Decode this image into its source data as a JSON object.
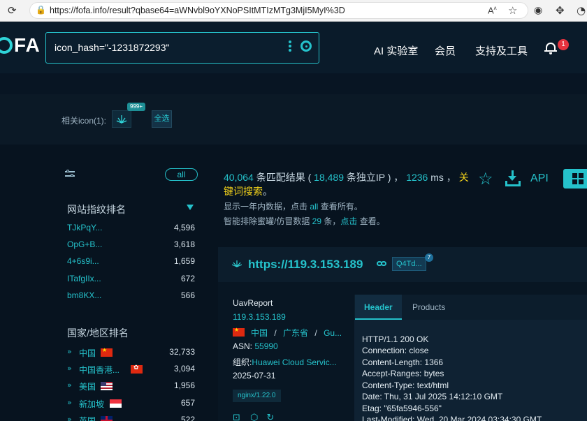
{
  "browser": {
    "url": "https://fofa.info/result?qbase64=aWNvbl9oYXNoPSItMTIzMTg3MjI5MyI%3D",
    "reader_label": "A",
    "icons": [
      "back-icon",
      "refresh-icon",
      "lock-icon",
      "read-aloud-icon",
      "favorite-icon",
      "browser-essentials-icon",
      "extensions-icon",
      "profile-icon"
    ]
  },
  "header": {
    "logo_text": "FA",
    "search_query": "icon_hash=\"-1231872293\"",
    "nav": [
      "AI 实验室",
      "会员",
      "支持及工具"
    ],
    "notification_count": "1"
  },
  "related_icons": {
    "label": "相关icon(1):",
    "count_badge": "999+",
    "select_all": "全选"
  },
  "sidebar": {
    "all_label": "all",
    "fingerprint_title": "网站指纹排名",
    "fingerprints": [
      {
        "name": "TJkPqY...",
        "count": "4,596"
      },
      {
        "name": "OpG+B...",
        "count": "3,618"
      },
      {
        "name": "4+6s9i...",
        "count": "1,659"
      },
      {
        "name": "ITafgIIx...",
        "count": "672"
      },
      {
        "name": "bm8KX...",
        "count": "566"
      }
    ],
    "country_title": "国家/地区排名",
    "countries": [
      {
        "name": "中国",
        "count": "32,733",
        "flag": "cn"
      },
      {
        "name": "中国香港...",
        "count": "3,094",
        "flag": "hk"
      },
      {
        "name": "美国",
        "count": "1,956",
        "flag": "us"
      },
      {
        "name": "新加坡",
        "count": "657",
        "flag": "sg"
      },
      {
        "name": "英国",
        "count": "522",
        "flag": "gb"
      }
    ]
  },
  "summary": {
    "total": "40,064",
    "total_suffix": " 条匹配结果 ( ",
    "unique_ip": "18,489",
    "unique_suffix": " 条独立IP ) ， ",
    "time": "1236",
    "time_suffix": " ms ， ",
    "keyword": "关键词搜索",
    "end": "。",
    "line2_prefix": "显示一年内数据，点击 ",
    "line2_link": "all",
    "line2_suffix": " 查看所有。",
    "line3_prefix": "智能排除蜜罐/仿冒数据 ",
    "line3_count": "29",
    "line3_mid": " 条，",
    "line3_link": "点击",
    "line3_suffix": " 查看。",
    "api_label": "API"
  },
  "result": {
    "host": "https://119.3.153.189",
    "tag": "Q4Td...",
    "tag_count": "7",
    "title": "UavReport",
    "ip": "119.3.153.189",
    "country": "中国",
    "separator": "/",
    "province": "广东省",
    "city": "Gu...",
    "asn_label": "ASN:",
    "asn": "55990",
    "org_label": "组织:",
    "org": "Huawei Cloud Servic...",
    "date": "2025-07-31",
    "server": "nginx/1.22.0",
    "tabs": [
      "Header",
      "Products"
    ],
    "header_lines": [
      "HTTP/1.1 200 OK",
      "Connection: close",
      "Content-Length: 1366",
      "Accept-Ranges: bytes",
      "Content-Type: text/html",
      "Date: Thu, 31 Jul 2025 14:12:10 GMT",
      "Etag: \"65fa5946-556\"",
      "Last-Modified: Wed, 20 Mar 2024 03:34:30 GMT"
    ]
  },
  "colors": {
    "accent": "#25c2cb",
    "keyword": "#f2d21b",
    "background": "#07131f",
    "badge": "#e5333f"
  }
}
